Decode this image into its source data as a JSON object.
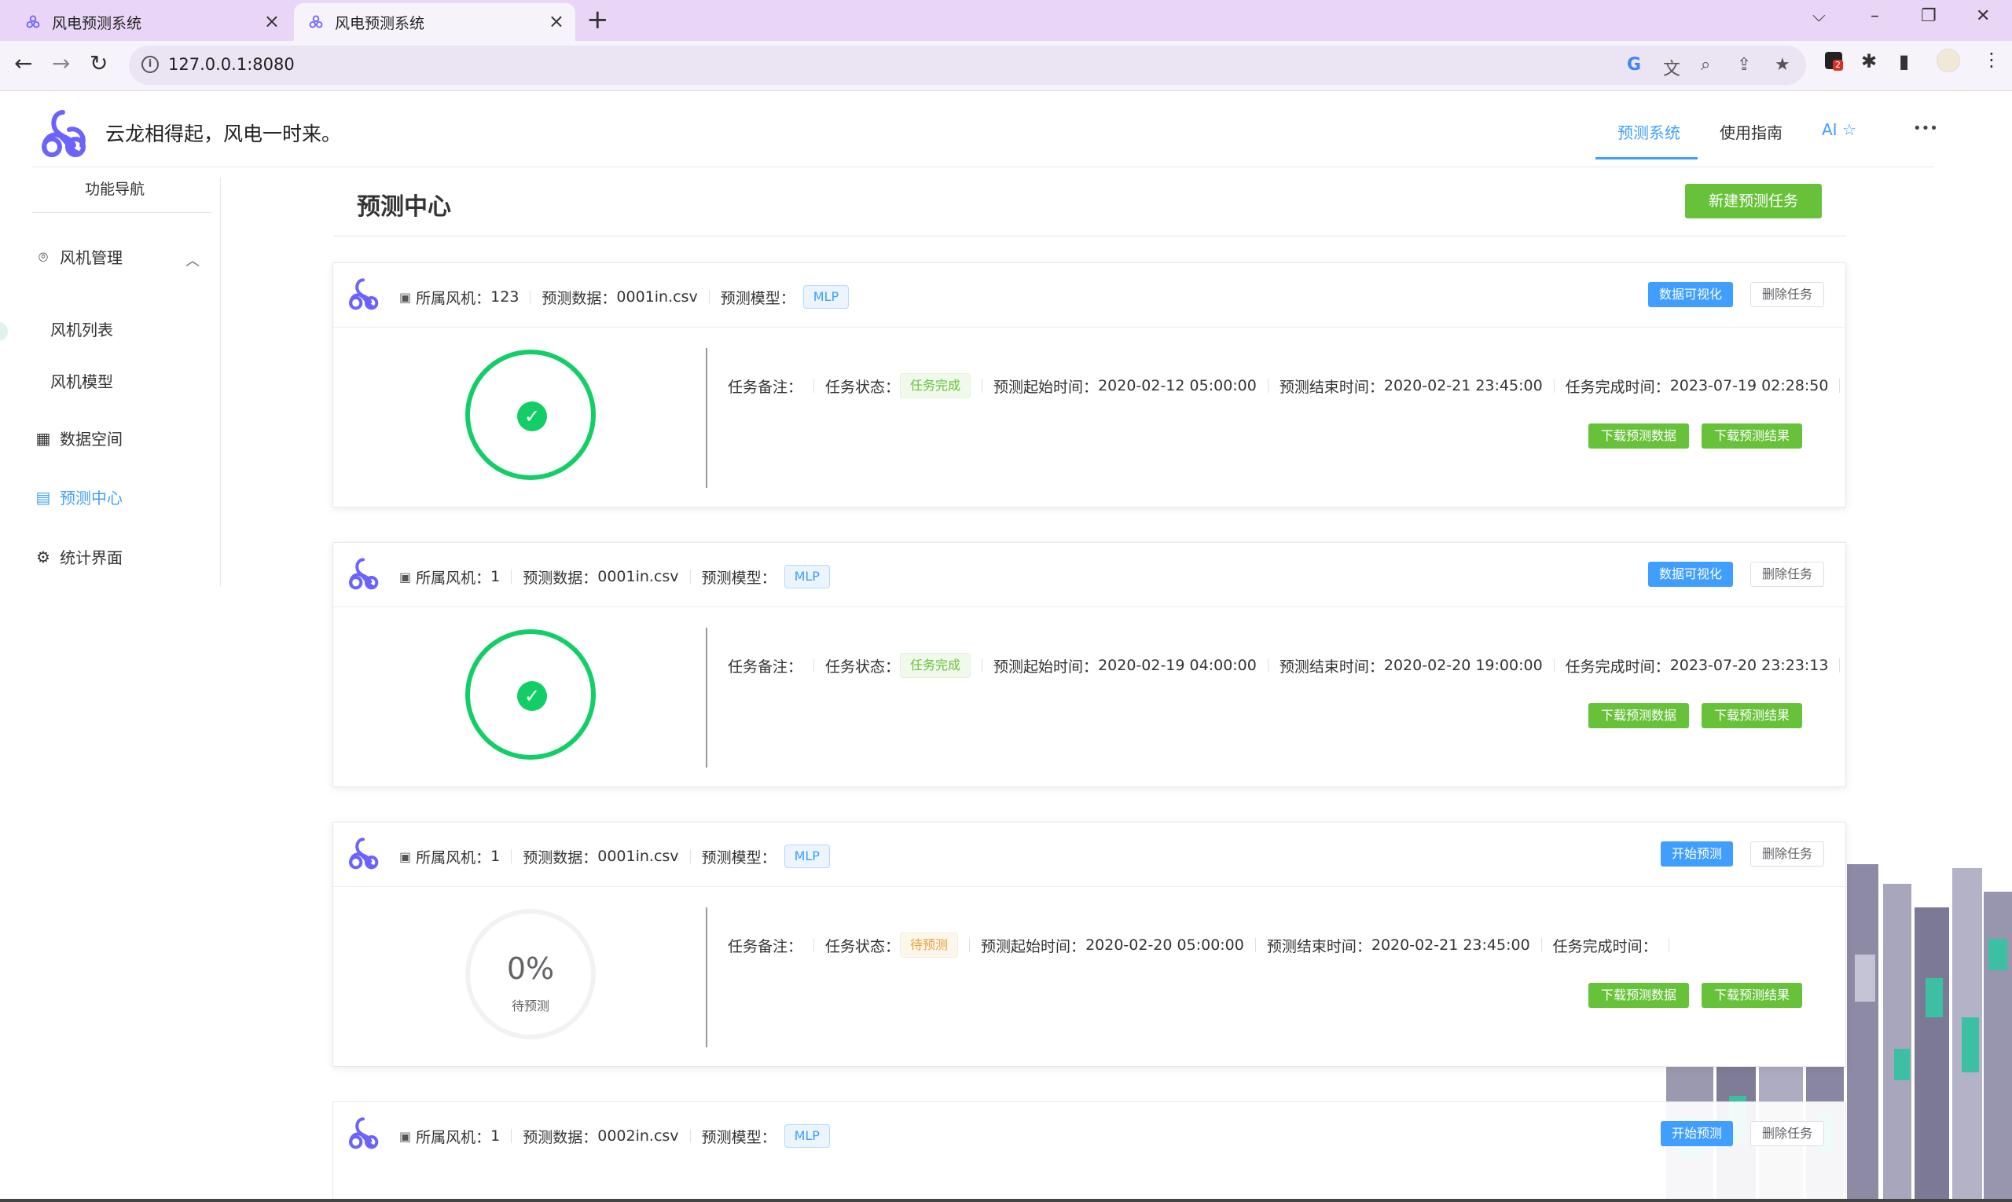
{
  "browser": {
    "tabs": [
      {
        "title": "风电预测系统",
        "active": false
      },
      {
        "title": "风电预测系统",
        "active": true
      }
    ],
    "url": "127.0.0.1:8080",
    "extension_badge": "2"
  },
  "header": {
    "slogan": "云龙相得起，风电一时来。",
    "nav": [
      "预测系统",
      "使用指南",
      "AI ☆"
    ],
    "more": "•••"
  },
  "sidebar": {
    "title": "功能导航",
    "groups": [
      {
        "label": "风机管理",
        "icon": "location-icon",
        "expanded": true,
        "children": [
          "风机列表",
          "风机模型"
        ]
      },
      {
        "label": "数据空间",
        "icon": "grid-icon"
      },
      {
        "label": "预测中心",
        "icon": "document-icon",
        "active": true
      },
      {
        "label": "统计界面",
        "icon": "gear-icon"
      }
    ]
  },
  "main": {
    "title": "预测中心",
    "new_task_label": "新建预测任务",
    "labels": {
      "turbine": "所属风机：",
      "data": "预测数据：",
      "model": "预测模型：",
      "note": "任务备注：",
      "status": "任务状态：",
      "start": "预测起始时间：",
      "end": "预测结束时间：",
      "finish": "任务完成时间：",
      "download_data": "下载预测数据",
      "download_result": "下载预测结果",
      "delete": "删除任务"
    },
    "tasks": [
      {
        "turbine": "123",
        "data_file": "0001in.csv",
        "model": "MLP",
        "action": "数据可视化",
        "note": "",
        "status": "任务完成",
        "start": "2020-02-12 05:00:00",
        "end": "2020-02-21 23:45:00",
        "finish": "2023-07-19 02:28:50",
        "progress": 1.0
      },
      {
        "turbine": "1",
        "data_file": "0001in.csv",
        "model": "MLP",
        "action": "数据可视化",
        "note": "",
        "status": "任务完成",
        "start": "2020-02-19 04:00:00",
        "end": "2020-02-20 19:00:00",
        "finish": "2023-07-20 23:23:13",
        "progress": 1.0
      },
      {
        "turbine": "1",
        "data_file": "0001in.csv",
        "model": "MLP",
        "action": "开始预测",
        "note": "",
        "status": "待预测",
        "start": "2020-02-20 05:00:00",
        "end": "2020-02-21 23:45:00",
        "finish": "",
        "progress": 0.0,
        "progress_text": "0%",
        "progress_label": "待预测"
      },
      {
        "turbine": "1",
        "data_file": "0002in.csv",
        "model": "MLP",
        "action": "开始预测"
      }
    ]
  },
  "colors": {
    "primary": "#409eff",
    "success": "#67c23a",
    "ring": "#13ce66",
    "warning": "#e6a23c",
    "logo": "#6c63ff"
  }
}
